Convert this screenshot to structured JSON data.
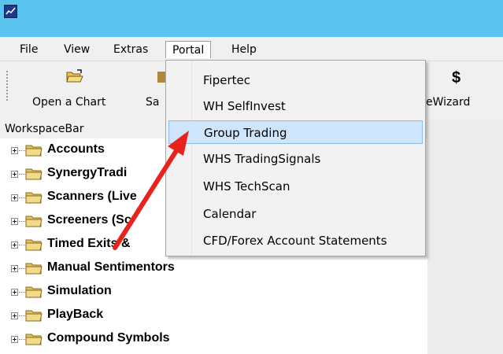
{
  "menubar": {
    "items": [
      "File",
      "View",
      "Extras",
      "Portal",
      "Help"
    ],
    "open_item": "Portal"
  },
  "toolbar": {
    "open_chart": "Open a Chart",
    "save_partial": "Sa",
    "wizard_partial": "eWizard"
  },
  "workspace": {
    "title": "WorkspaceBar"
  },
  "tree": {
    "items": [
      "Accounts",
      "SynergyTradi",
      "Scanners (Live",
      "Screeners (Sc",
      "Timed Exits &",
      "Manual Sentimentors",
      "Simulation",
      "PlayBack",
      "Compound Symbols"
    ]
  },
  "portal_menu": {
    "items": [
      "Fipertec",
      "WH SelfInvest",
      "Group Trading",
      "WHS TradingSignals",
      "WHS TechScan",
      "Calendar",
      "CFD/Forex Account Statements"
    ],
    "highlighted": "Group Trading"
  },
  "icons": {
    "toolbar_open": "open-folder-icon",
    "toolbar_dollar": "dollar-icon",
    "tree_folder": "folder-icon"
  },
  "colors": {
    "titlebar": "#5bc4ee",
    "highlight": "#cfe5fb",
    "arrow": "#e8231e"
  }
}
